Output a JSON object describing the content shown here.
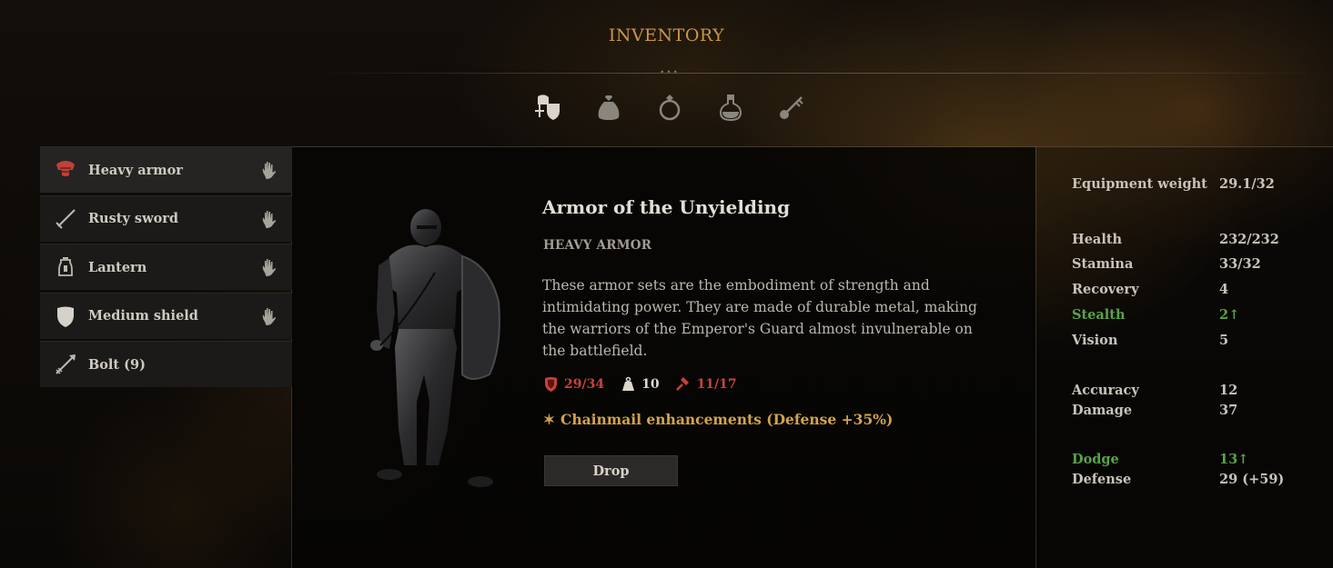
{
  "title": "INVENTORY",
  "tabs": [
    {
      "icon": "armor-and-weapons-icon",
      "active": true
    },
    {
      "icon": "bag-icon",
      "active": false
    },
    {
      "icon": "ring-icon",
      "active": false
    },
    {
      "icon": "potion-icon",
      "active": false
    },
    {
      "icon": "key-icon",
      "active": false
    }
  ],
  "items": [
    {
      "label": "Heavy armor",
      "icon": "heavy-armor-icon",
      "equipped": true,
      "selected": true
    },
    {
      "label": "Rusty sword",
      "icon": "sword-icon",
      "equipped": true
    },
    {
      "label": "Lantern",
      "icon": "lantern-icon",
      "equipped": true
    },
    {
      "label": "Medium shield",
      "icon": "shield-icon",
      "equipped": true
    },
    {
      "label": "Bolt (9)",
      "icon": "bolt-icon",
      "equipped": false
    }
  ],
  "detail": {
    "name": "Armor of the Unyielding",
    "type": "HEAVY ARMOR",
    "description": "These armor sets are the embodiment of strength and intimidating power. They are made of durable metal, making the warriors of the Emperor's Guard almost invulnerable on the battlefield.",
    "defense": "29/34",
    "weight": "10",
    "durability": "11/17",
    "enhancement_mark": "✶",
    "enhancement": "Chainmail enhancements (Defense +35%)",
    "drop_label": "Drop"
  },
  "stats": {
    "equipment_weight": {
      "label": "Equipment weight",
      "value": "29.1/32"
    },
    "health": {
      "label": "Health",
      "value": "232/232"
    },
    "stamina": {
      "label": "Stamina",
      "value": "33/32"
    },
    "recovery": {
      "label": "Recovery",
      "value": "4"
    },
    "stealth": {
      "label": "Stealth",
      "value": "2↑"
    },
    "vision": {
      "label": "Vision",
      "value": "5"
    },
    "accuracy": {
      "label": "Accuracy",
      "value": "12"
    },
    "damage": {
      "label": "Damage",
      "value": "37"
    },
    "dodge": {
      "label": "Dodge",
      "value": "13↑"
    },
    "defense": {
      "label": "Defense",
      "value": "29 (+59)"
    }
  },
  "colors": {
    "accent_gold": "#c9954a",
    "stat_red": "#c9423a",
    "buff_green": "#5aa24a",
    "enhancement_gold": "#d3a34a"
  }
}
